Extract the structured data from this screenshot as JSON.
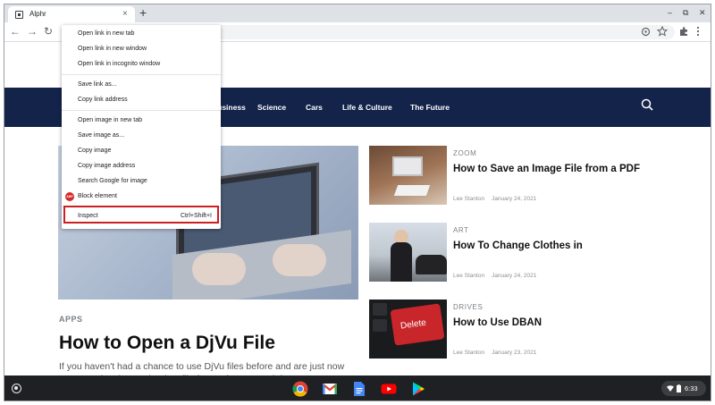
{
  "browser": {
    "tab_title": "Alphr",
    "tab_close": "×",
    "new_tab": "+",
    "controls": {
      "minimize": "–",
      "maximize": "⧉",
      "close": "✕"
    }
  },
  "toolbar": {
    "back": "←",
    "forward": "→",
    "reload": "↻"
  },
  "site_nav": {
    "items": [
      "Business",
      "Science",
      "Cars",
      "Life & Culture",
      "The Future"
    ]
  },
  "hero": {
    "category": "APPS",
    "title": "How to Open a DjVu File",
    "excerpt": "If you haven't had a chance to use DjVu files before and are just now encountering them, DjVu is a file format for scanned document..."
  },
  "cards": [
    {
      "category": "ZOOM",
      "title": "How to Save an Image File from a PDF",
      "author": "Lee Stanton",
      "date": "January 24, 2021"
    },
    {
      "category": "ART",
      "title": "How To Change Clothes in",
      "author": "Lee Stanton",
      "date": "January 24, 2021"
    },
    {
      "category": "DRIVES",
      "title": "How to Use DBAN",
      "author": "Lee Stanton",
      "date": "January 23, 2021",
      "image_label": "Delete"
    }
  ],
  "context_menu": {
    "groups": [
      [
        "Open link in new tab",
        "Open link in new window",
        "Open link in incognito window"
      ],
      [
        "Save link as...",
        "Copy link address"
      ],
      [
        "Open image in new tab",
        "Save image as...",
        "Copy image",
        "Copy image address",
        "Search Google for image",
        "Block element"
      ]
    ],
    "block_badge": "ABP",
    "inspect": {
      "label": "Inspect",
      "shortcut": "Ctrl+Shift+I"
    }
  },
  "shelf": {
    "apps": [
      "chrome-icon",
      "gmail-icon",
      "docs-icon",
      "youtube-icon",
      "play-store-icon"
    ],
    "time": "6:33"
  }
}
